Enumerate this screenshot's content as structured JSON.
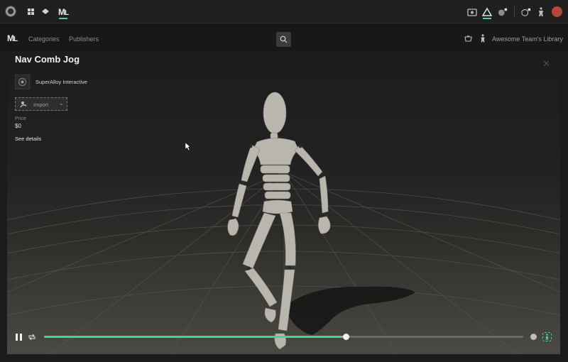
{
  "nav": {
    "categories": "Categories",
    "publishers": "Publishers",
    "library": "Awesome Team's Library"
  },
  "product": {
    "title": "Nav Comb Jog",
    "publisher": "SuperAlloy Interactive",
    "import_label": "Import",
    "price_label": "Price",
    "price_value": "$0",
    "see_details": "See details"
  },
  "playback": {
    "progress": 0.63
  },
  "colors": {
    "accent": "#4ad08f",
    "avatar": "#b5473a"
  },
  "icons": {
    "app_logo": "unreal-logo-icon",
    "grid": "grid-icon",
    "diamond": "diamond-icon",
    "search": "search-icon",
    "basket": "basket-icon",
    "person": "person-icon",
    "close": "close-icon",
    "pause": "pause-icon",
    "loop": "loop-icon"
  }
}
